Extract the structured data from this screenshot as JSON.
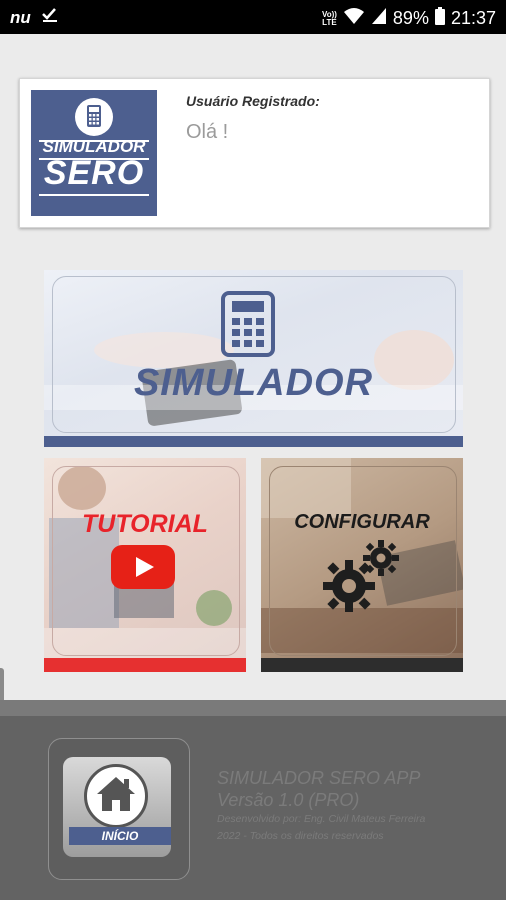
{
  "status_bar": {
    "carrier_logo": "nu",
    "network_label_top": "Vo))",
    "network_label_bottom": "LTE",
    "battery": "89%",
    "time": "21:37",
    "icons": [
      "nu-logo-icon",
      "download-done-icon",
      "volte-icon",
      "wifi-icon",
      "signal-icon",
      "battery-icon"
    ]
  },
  "user_card": {
    "logo_line1": "SIMULADOR",
    "logo_line2": "SERO",
    "label": "Usuário Registrado:",
    "greeting": "Olá !"
  },
  "tiles": {
    "simulador": "SIMULADOR",
    "tutorial": "TUTORIAL",
    "configurar": "CONFIGURAR"
  },
  "footer": {
    "home_label": "INÍCIO",
    "app_name": "SIMULADOR SERO APP",
    "version": "Versão 1.0 (PRO)",
    "developer": "Desenvolvido por: Eng. Civil Mateus Ferreira",
    "copyright": "2022 - Todos os direitos reservados"
  },
  "colors": {
    "brand_blue": "#4d5f8f",
    "tutorial_red": "#e63030",
    "config_dark": "#2d2d2d",
    "youtube_red": "#e62117",
    "footer_gray": "#636363"
  }
}
